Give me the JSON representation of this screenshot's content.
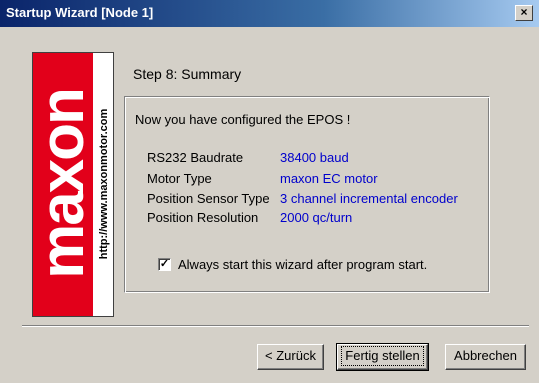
{
  "window": {
    "title": "Startup Wizard  [Node 1]",
    "close_label": "×"
  },
  "logo": {
    "brand": "maxon",
    "url": "http://www.maxonmotor.com"
  },
  "step": {
    "title": "Step 8: Summary"
  },
  "summary": {
    "intro": "Now you have configured the EPOS !",
    "rows": [
      {
        "label": "RS232 Baudrate",
        "value": "38400 baud"
      },
      {
        "label": "Motor Type",
        "value": "maxon EC motor"
      },
      {
        "label": "Position Sensor Type",
        "value": "3 channel incremental encoder"
      },
      {
        "label": "Position Resolution",
        "value": "2000 qc/turn"
      }
    ],
    "checkbox": {
      "checked": true,
      "mark": "✓",
      "label": "Always start this wizard after program start."
    }
  },
  "buttons": {
    "back": "< Zurück",
    "finish": "Fertig stellen",
    "cancel": "Abbrechen"
  },
  "colors": {
    "value_text": "#0000cc",
    "brand_red": "#e2001a",
    "title_bar": "#0a246a"
  }
}
